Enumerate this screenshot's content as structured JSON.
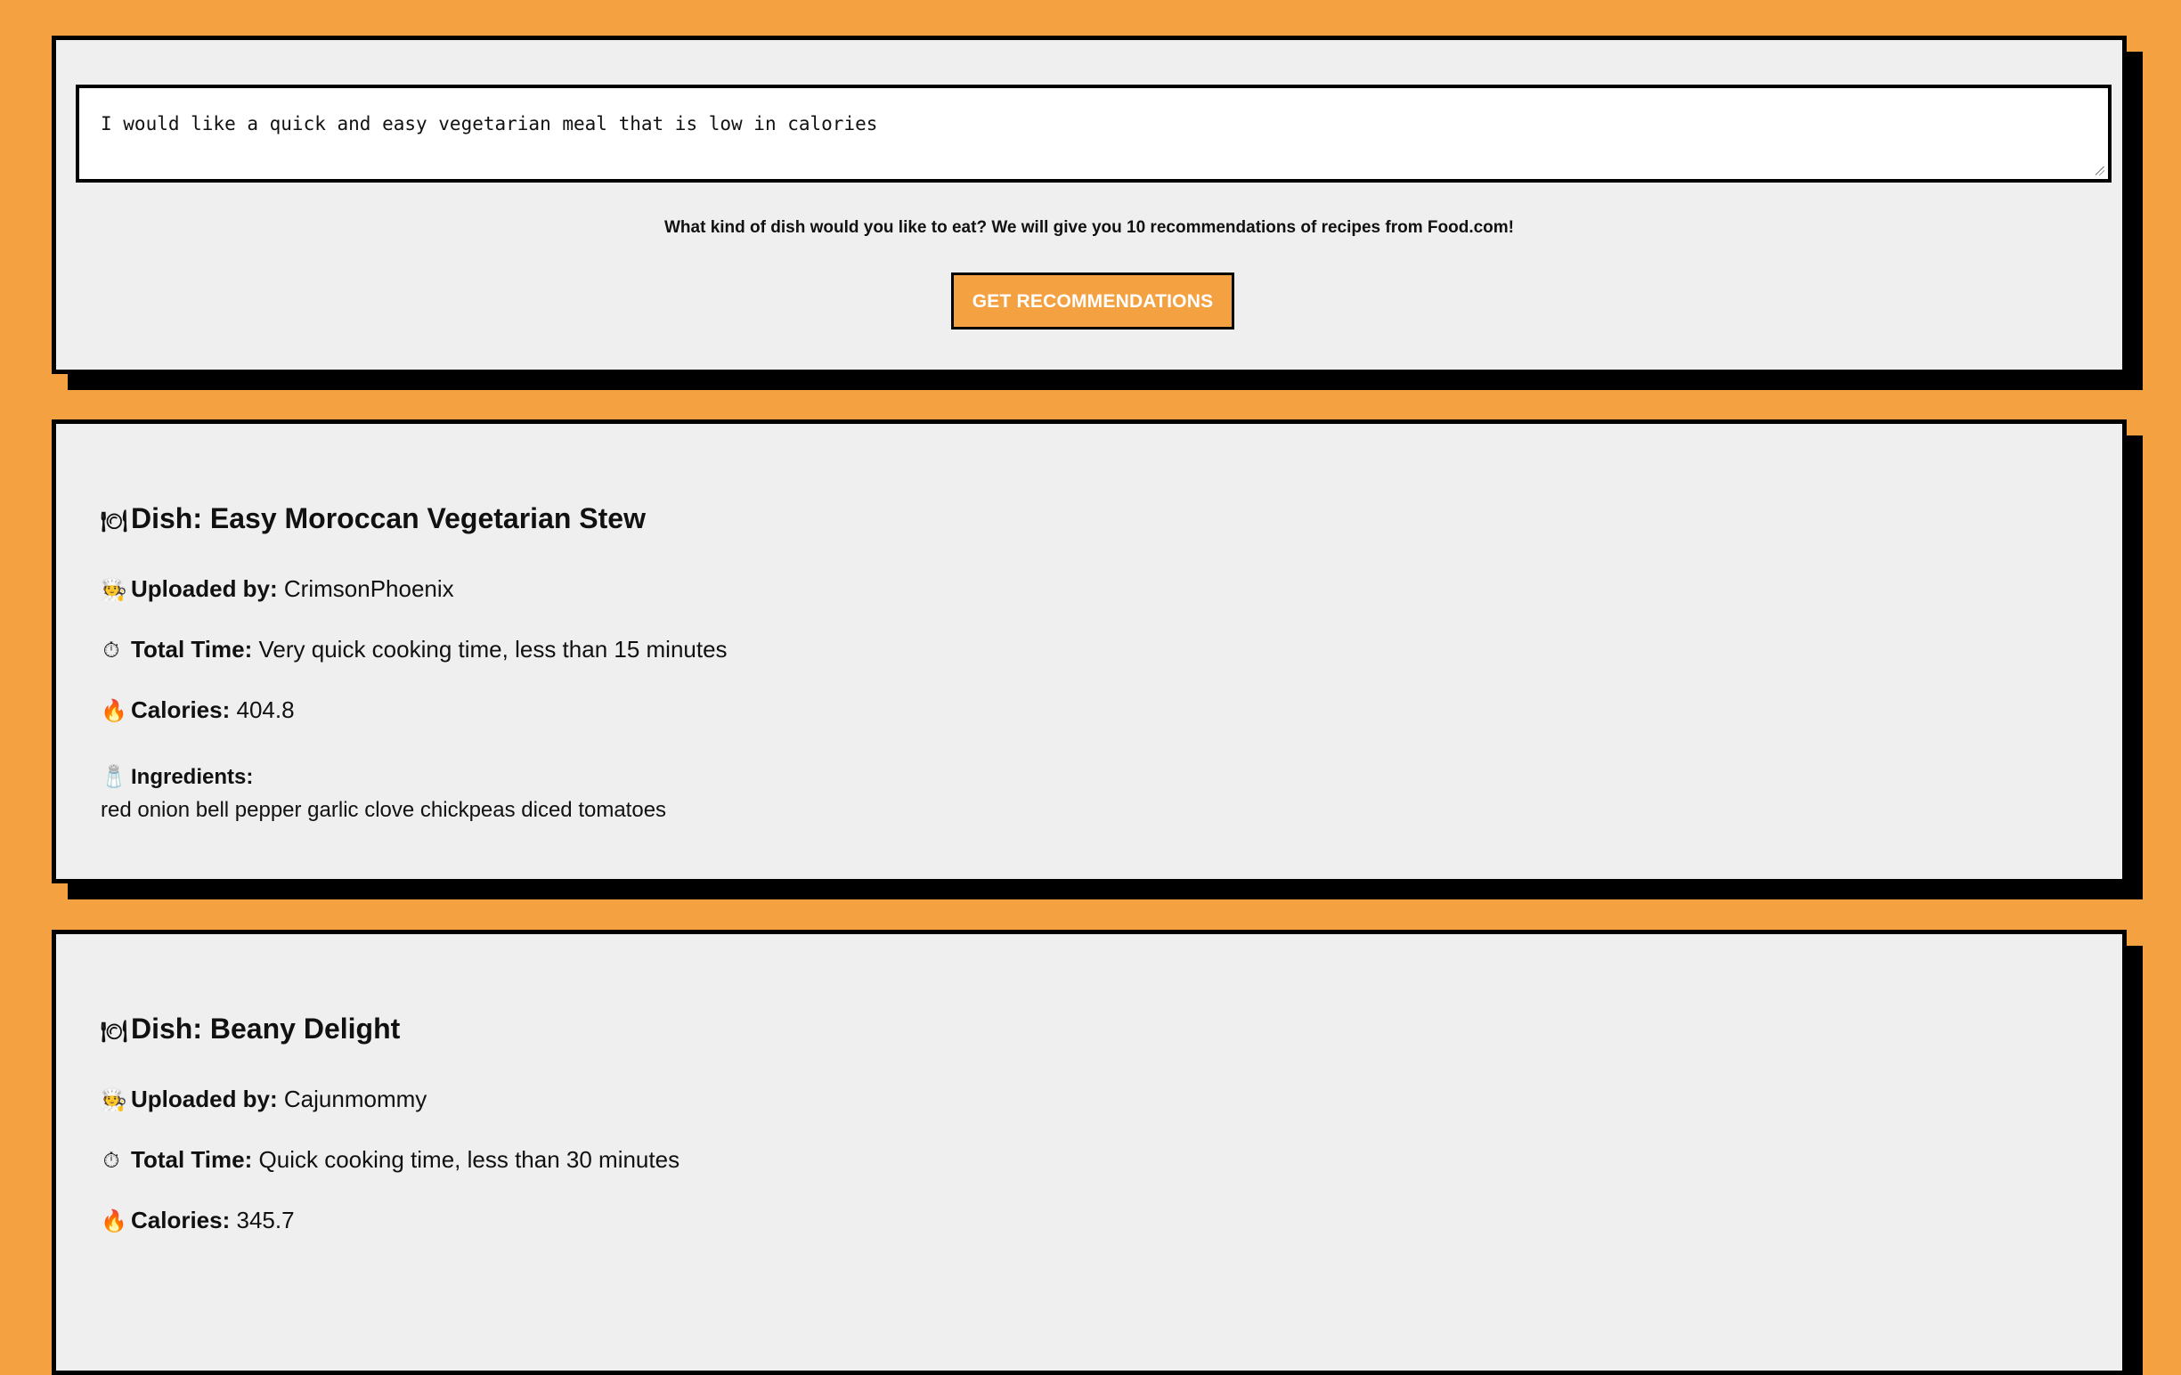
{
  "search": {
    "query": "I would like a quick and easy vegetarian meal that is low in calories",
    "helper_text": "What kind of dish would you like to eat? We will give you 10 recommendations of recipes from Food.com!",
    "button_label": "GET RECOMMENDATIONS"
  },
  "recipes": [
    {
      "dish_icon": "🍽",
      "dish_title": "Dish: Easy Moroccan Vegetarian Stew",
      "uploader_icon": "🧑‍🍳",
      "uploader_label": "Uploaded by:",
      "uploader": "CrimsonPhoenix",
      "time_icon": "⏱",
      "time_label": "Total Time:",
      "total_time": "Very quick cooking time, less than 15 minutes",
      "calories_icon": "🔥",
      "calories_label": "Calories:",
      "calories": "404.8",
      "ingredients_icon": "🧂",
      "ingredients_label": "Ingredients:",
      "ingredients": "red onion bell pepper garlic clove chickpeas diced tomatoes"
    },
    {
      "dish_icon": "🍽",
      "dish_title": "Dish: Beany Delight",
      "uploader_icon": "🧑‍🍳",
      "uploader_label": "Uploaded by:",
      "uploader": "Cajunmommy",
      "time_icon": "⏱",
      "time_label": "Total Time:",
      "total_time": "Quick cooking time, less than 30 minutes",
      "calories_icon": "🔥",
      "calories_label": "Calories:",
      "calories": "345.7"
    }
  ]
}
